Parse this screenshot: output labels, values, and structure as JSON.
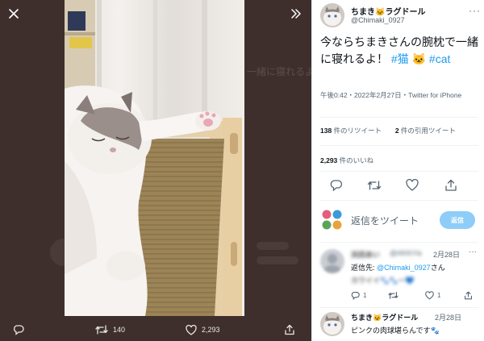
{
  "viewer": {
    "ghost_text": "一緒に寝れるよ",
    "retweet_count": "140",
    "like_count": "2,293",
    "controls": {
      "close_icon": "close-icon",
      "expand_icon": "double-chevron-right-icon",
      "reply_icon": "comment-icon",
      "retweet_icon": "retweet-icon",
      "like_icon": "heart-icon",
      "share_icon": "share-icon"
    }
  },
  "tweet": {
    "author_name": "ちまき🐱ラグドール",
    "author_handle": "@Chimaki_0927",
    "text_line": "今ならちまきさんの腕枕で一緒に寝れるよ！",
    "hashtag_1": "#猫",
    "emoji": "🐱",
    "hashtag_2": "#cat",
    "meta_line": "午後0:42・2022年2月27日・Twitter for iPhone",
    "retweets_count": "138",
    "retweets_label": " 件のリツイート",
    "quotes_count": "2",
    "quotes_label": " 件の引用ツイート",
    "likes_count": "2,293",
    "likes_label": " 件のいいね"
  },
  "reply_composer": {
    "placeholder": "返信をツイート",
    "button_label": "返信"
  },
  "replies": [
    {
      "name": "浜田あい",
      "handle": "@AKKiYa",
      "time": "2月28日",
      "reply_to_label": "返信先: ",
      "reply_to_handle": "@Chimaki_0927",
      "reply_to_suffix": "さん",
      "body": "カワイイ🐾🐾ー💙",
      "reply_count": "1",
      "retweet_count": "",
      "like_count": "1"
    },
    {
      "name": "ちまき🐱ラグドール",
      "time": "2月28日",
      "body": "ピンクの肉球堪らんです🐾"
    }
  ],
  "colors": {
    "viewer_bg": "#3e2f2d",
    "link_blue": "#1d9bf0",
    "reply_button": "#8ecdf7",
    "secondary_text": "#536471"
  }
}
